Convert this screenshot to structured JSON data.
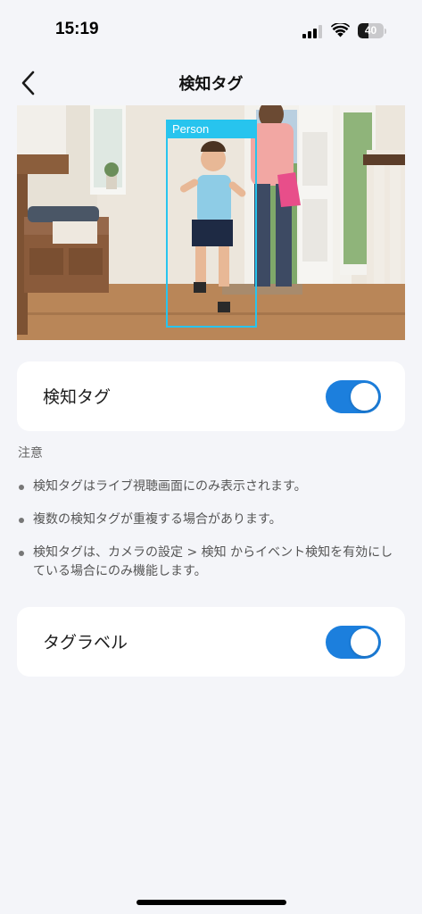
{
  "status_bar": {
    "time": "15:19",
    "battery": "40",
    "battery_level": 0.4
  },
  "nav": {
    "title": "検知タグ",
    "back_icon": "chevron-left-icon"
  },
  "preview": {
    "detection_label": "Person"
  },
  "detection_tag": {
    "label": "検知タグ",
    "enabled": true
  },
  "notes": {
    "heading": "注意",
    "items": [
      "検知タグはライブ視聴画面にのみ表示されます。",
      "複数の検知タグが重複する場合があります。",
      "検知タグは、カメラの設定 > 検知 からイベント検知を有効にしている場合にのみ機能します。"
    ]
  },
  "tag_label": {
    "label": "タグラベル",
    "enabled": true
  },
  "colors": {
    "accent": "#1c7fdd",
    "detection_box": "#27c4ee",
    "background": "#f4f5f9"
  }
}
